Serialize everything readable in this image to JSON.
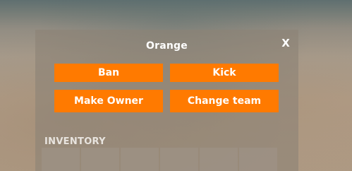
{
  "dialog": {
    "title": "Orange",
    "close_label": "X"
  },
  "actions": {
    "ban": "Ban",
    "kick": "Kick",
    "make_owner": "Make Owner",
    "change_team": "Change team"
  },
  "inventory": {
    "label": "INVENTORY",
    "slots": [
      "",
      "",
      "",
      "",
      "",
      ""
    ]
  },
  "colors": {
    "button_bg": "#ff7a00",
    "button_text": "#ffffff",
    "panel_bg": "rgba(140,130,118,0.62)"
  }
}
